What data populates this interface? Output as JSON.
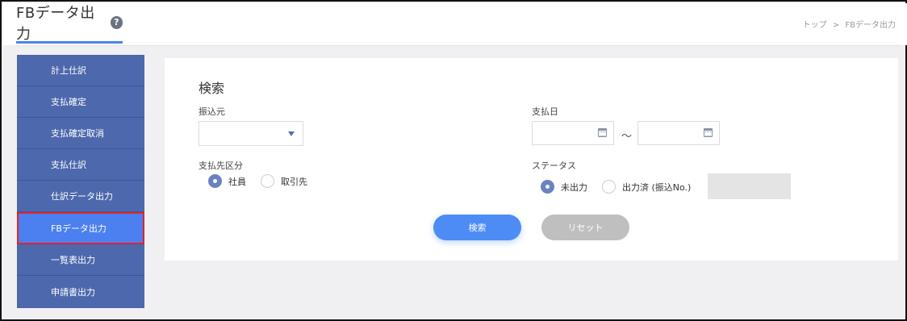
{
  "header": {
    "title": "FBデータ出力",
    "help_glyph": "?",
    "breadcrumb": {
      "home": "トップ",
      "separator": ">",
      "current": "FBデータ出力"
    }
  },
  "sidebar": {
    "items": [
      {
        "label": "計上仕訳"
      },
      {
        "label": "支払確定"
      },
      {
        "label": "支払確定取消"
      },
      {
        "label": "支払仕訳"
      },
      {
        "label": "仕訳データ出力"
      },
      {
        "label": "FBデータ出力",
        "active": true
      },
      {
        "label": "一覧表出力"
      },
      {
        "label": "申請書出力"
      }
    ]
  },
  "search": {
    "title": "検索",
    "furikomimoto": {
      "label": "振込元",
      "value": ""
    },
    "payment_date": {
      "label": "支払日",
      "from": "",
      "to": "",
      "separator": "～"
    },
    "payee_type": {
      "label": "支払先区分",
      "options": [
        {
          "label": "社員",
          "checked": true
        },
        {
          "label": "取引先",
          "checked": false
        }
      ]
    },
    "status": {
      "label": "ステータス",
      "options": [
        {
          "label": "未出力",
          "checked": true
        },
        {
          "label": "出力済 (振込No.)",
          "checked": false
        }
      ],
      "number_value": ""
    },
    "search_button": "検索",
    "reset_button": "リセット"
  },
  "colors": {
    "sidebar_bg": "#4d68ad",
    "sidebar_active": "#4c7ff0",
    "active_outline": "#e0242b",
    "primary_button": "#4d8cf5",
    "reset_button": "#bfbfbf",
    "title_underline": "#4a86e8"
  }
}
